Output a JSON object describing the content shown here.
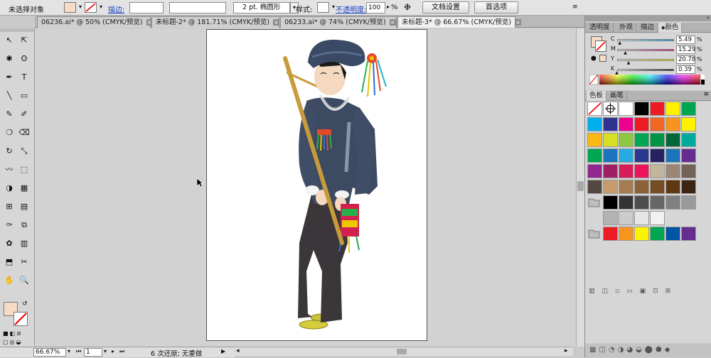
{
  "control_bar": {
    "selection": "未选择对象",
    "stroke_label": "描边:",
    "stroke_weight": "2 pt.",
    "brush": "椭圆形",
    "style_label": "样式:",
    "opacity_label": "不透明度:",
    "opacity_value": "100",
    "opacity_unit": "%",
    "doc_setup": "文档设置",
    "preferences": "首选项"
  },
  "tabs": [
    {
      "label": "06236.ai* @ 50% (CMYK/预览)",
      "active": false
    },
    {
      "label": "未标题-2* @ 181.71% (CMYK/预览)",
      "active": false
    },
    {
      "label": "06233.ai* @ 74% (CMYK/预览)",
      "active": false
    },
    {
      "label": "未标题-3* @ 66.67% (CMYK/预览)",
      "active": true
    }
  ],
  "tab_close_glyph": "×",
  "status_bar": {
    "zoom": "66.67%",
    "page": "1",
    "message": "6 次还原; 无重做"
  },
  "panel_color": {
    "tabs": [
      "透明度",
      "外观",
      "描边",
      "颜色"
    ],
    "channels": [
      {
        "name": "C",
        "value": "5.49",
        "color": "#00aeef"
      },
      {
        "name": "M",
        "value": "15.29",
        "color": "#ec008c"
      },
      {
        "name": "Y",
        "value": "20.78",
        "color": "#fff200"
      },
      {
        "name": "K",
        "value": "0.39",
        "color": "#000000"
      }
    ],
    "fill_color": "#f6dcc6"
  },
  "panel_swatches": {
    "tabs": [
      "色板",
      "画笔"
    ],
    "rows": [
      [
        "none",
        "registration",
        "#ffffff",
        "#000000",
        "#ed1c24",
        "#fff200",
        "#00a651"
      ],
      [
        "#00aeef",
        "#2e3192",
        "#ec008c",
        "#ed1c24",
        "#f26522",
        "#f7941d",
        "#fff200"
      ],
      [
        "#fdb913",
        "#d7df23",
        "#8dc63f",
        "#00a651",
        "#009444",
        "#006838",
        "#00a99d"
      ],
      [
        "#00a651",
        "#1b75bc",
        "#27aae1",
        "#2b388f",
        "#262262",
        "#1c75bc",
        "#662d91"
      ],
      [
        "#92278f",
        "#9e1f63",
        "#d91c5c",
        "#ed145b",
        "#c2b59b",
        "#998675",
        "#736357"
      ],
      [
        "#534741",
        "#c69c6d",
        "#a67c52",
        "#8c6239",
        "#754c24",
        "#603913",
        "#3c2415"
      ],
      [
        "folder",
        "#000000",
        "#333333",
        "#4d4d4d",
        "#666666",
        "#808080",
        "#999999"
      ],
      [
        "",
        "#b3b3b3",
        "#cccccc",
        "#e6e6e6",
        "#f2f2f2",
        "",
        ""
      ],
      [
        "folder",
        "#ed1c24",
        "#f7941d",
        "#fff200",
        "#00a651",
        "#0054a6",
        "#662d91"
      ]
    ]
  },
  "tools": [
    "selection-tool",
    "direct-selection-tool",
    "magic-wand-tool",
    "lasso-tool",
    "pen-tool",
    "type-tool",
    "line-tool",
    "rectangle-tool",
    "paintbrush-tool",
    "pencil-tool",
    "blob-brush-tool",
    "eraser-tool",
    "rotate-tool",
    "scale-tool",
    "warp-tool",
    "free-transform-tool",
    "shape-builder-tool",
    "perspective-tool",
    "mesh-tool",
    "gradient-tool",
    "eyedropper-tool",
    "blend-tool",
    "symbol-sprayer-tool",
    "column-graph-tool",
    "artboard-tool",
    "slice-tool",
    "hand-tool",
    "zoom-tool"
  ],
  "tool_glyphs": [
    "↖",
    "⇱",
    "✱",
    "ʘ",
    "✒",
    "T",
    "╲",
    "▭",
    "✎",
    "✐",
    "❍",
    "⌫",
    "↻",
    "⤡",
    "〰",
    "⬚",
    "◑",
    "▦",
    "⊞",
    "▤",
    "✑",
    "⧉",
    "✿",
    "▥",
    "⬒",
    "✂",
    "✋",
    "🔍"
  ]
}
